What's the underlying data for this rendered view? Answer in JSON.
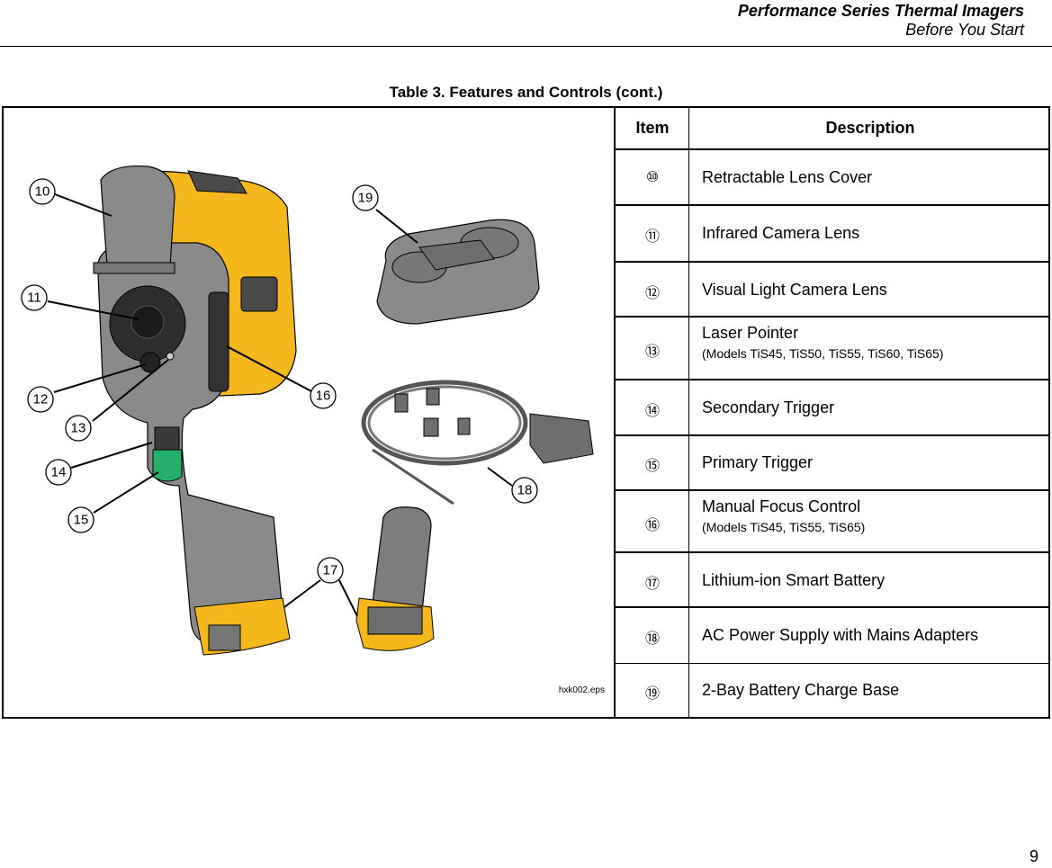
{
  "header": {
    "title": "Performance Series Thermal Imagers",
    "subtitle": "Before You Start"
  },
  "table": {
    "caption": "Table 3. Features and Controls (cont.)",
    "columns": [
      "Item",
      "Description"
    ],
    "rows": [
      {
        "item": "⑩",
        "description": "Retractable Lens Cover",
        "note": ""
      },
      {
        "item": "⑪",
        "description": "Infrared Camera Lens",
        "note": ""
      },
      {
        "item": "⑫",
        "description": "Visual Light Camera Lens",
        "note": ""
      },
      {
        "item": "⑬",
        "description": "Laser Pointer",
        "note": "(Models TiS45, TiS50, TiS55, TiS60, TiS65)"
      },
      {
        "item": "⑭",
        "description": "Secondary Trigger",
        "note": ""
      },
      {
        "item": "⑮",
        "description": "Primary Trigger",
        "note": ""
      },
      {
        "item": "⑯",
        "description": "Manual Focus Control",
        "note": "(Models TiS45, TiS55, TiS65)"
      },
      {
        "item": "⑰",
        "description": "Lithium-ion Smart Battery",
        "note": ""
      },
      {
        "item": "⑱",
        "description": "AC Power Supply with Mains Adapters",
        "note": ""
      },
      {
        "item": "⑲",
        "description": "2-Bay Battery Charge Base",
        "note": ""
      }
    ]
  },
  "figure": {
    "file_label": "hxk002.eps",
    "callouts": [
      "10",
      "11",
      "12",
      "13",
      "14",
      "15",
      "16",
      "17",
      "18",
      "19"
    ],
    "colors": {
      "body_yellow": "#f5b81c",
      "body_gray": "#8a8a8a",
      "dark_gray": "#4a4a4a",
      "trigger_green": "#25b06a"
    }
  },
  "page_number": "9"
}
